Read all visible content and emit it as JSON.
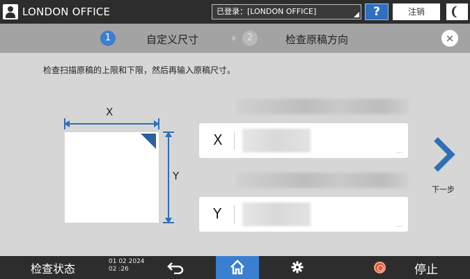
{
  "topbar": {
    "user_name": "LONDON OFFICE",
    "login_text": "已登录：[LONDON OFFICE]",
    "help_label": "?",
    "logout_label": "注销"
  },
  "steps": [
    {
      "number": "1",
      "label": "自定义尺寸",
      "active": true
    },
    {
      "number": "2",
      "label": "检查原稿方向",
      "active": false
    }
  ],
  "close_label": "×",
  "instruction": "检查扫描原稿的上限和下限，然后再输入原稿尺寸。",
  "diagram": {
    "x_label": "X",
    "y_label": "Y"
  },
  "fields": {
    "x": {
      "label": "X",
      "more": "..."
    },
    "y": {
      "label": "Y",
      "more": "..."
    }
  },
  "next_label": "下一步",
  "bottombar": {
    "status_label": "检查状态",
    "date": "01 02 2024",
    "time": "02 :26",
    "stop_label": "停止"
  },
  "colors": {
    "accent_blue": "#3c7ecf",
    "topbar": "#2d2d2d",
    "stop_red": "#e05535"
  }
}
